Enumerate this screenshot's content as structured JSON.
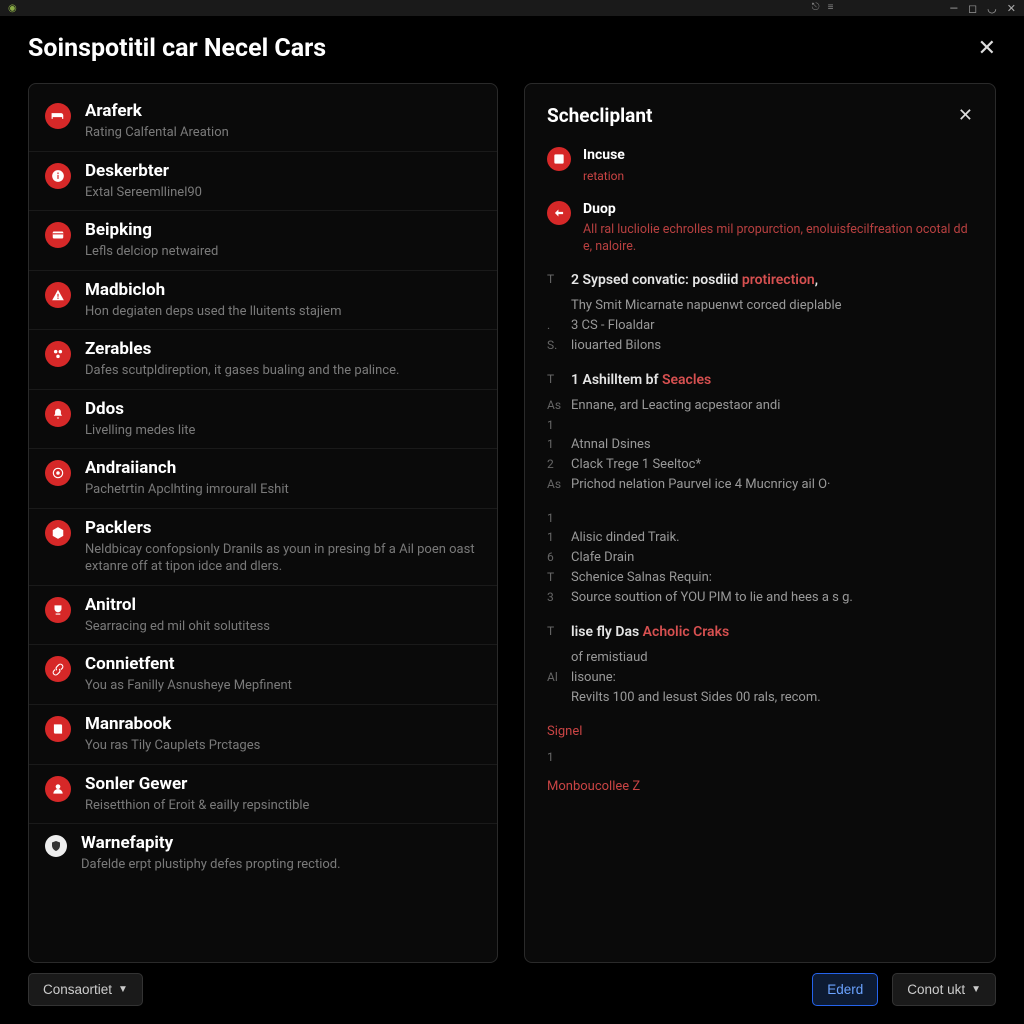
{
  "titlebar": {
    "win_min": "—",
    "win_max": "◻",
    "win_close": "✕"
  },
  "header": {
    "title": "Soinspotitil car Necel Cars",
    "close": "✕"
  },
  "left": {
    "items": [
      {
        "icon": "bed",
        "title": "Araferk",
        "desc": "Rating Calfental Areation"
      },
      {
        "icon": "info",
        "title": "Deskerbter",
        "desc": "Extal Sereemllinel90"
      },
      {
        "icon": "card",
        "title": "Beipking",
        "desc": "Lefls delciop netwaired"
      },
      {
        "icon": "warning",
        "title": "Madbicloh",
        "desc": "Hon degiaten deps used the lluitents stajiem"
      },
      {
        "icon": "circles",
        "title": "Zerables",
        "desc": "Dafes scutpldireption, it gases bualing and the palince."
      },
      {
        "icon": "bell",
        "title": "Ddos",
        "desc": "Livelling medes lite"
      },
      {
        "icon": "target",
        "title": "Andraiianch",
        "desc": "Pachetrtin Apclhting imrourall Eshit"
      },
      {
        "icon": "package",
        "title": "Packlers",
        "desc": "Neldbicay confopsionly Dranils as youn in presing bf a Ail poen oast extanre off at tipon idce and dlers."
      },
      {
        "icon": "cup",
        "title": "Anitrol",
        "desc": "Searracing ed mil ohit solutitess"
      },
      {
        "icon": "link",
        "title": "Connietfent",
        "desc": "You as Fanilly Asnusheye Mepfinent"
      },
      {
        "icon": "book",
        "title": "Manrabook",
        "desc": "You ras Tily Cauplets Prctages"
      },
      {
        "icon": "user",
        "title": "Sonler Gewer",
        "desc": "Reisetthion of Eroit & eailly repsinctible"
      },
      {
        "icon": "shield",
        "title": "Warnefapity",
        "desc": "Dafelde erpt plustiphy defes propting rectiod."
      }
    ]
  },
  "right": {
    "title": "Schecliplant",
    "close": "✕",
    "incuse": {
      "title": "Incuse",
      "sub": "retation"
    },
    "duop": {
      "title": "Duop",
      "text": "All ral lucliolie echrolles mil propurction, enoluisfecilfreation ocotal dd e, naloire."
    },
    "sections": [
      {
        "head_marker": "T",
        "head_pre": "2 Sypsed convatic: posdiid ",
        "head_hl": "protirection",
        "head_post": ",",
        "lines": [
          {
            "m": "",
            "t": "Thy Smit Micarnate napuenwt corced dieplable"
          },
          {
            "m": ".",
            "t": "3   CS - Floaldar"
          },
          {
            "m": "S.",
            "t": "liouarted Bilons"
          }
        ]
      },
      {
        "head_marker": "T",
        "head_pre": "1   Ashilltem bf ",
        "head_hl": "Seacles",
        "head_post": "",
        "lines": [
          {
            "m": "As",
            "t": "Ennane, ard Leacting acpestaor andi"
          },
          {
            "m": "1",
            "t": ""
          },
          {
            "m": "1",
            "t": "Atnnal Dsines"
          },
          {
            "m": "2",
            "t": "Clack Trege 1 Seeltoc*"
          },
          {
            "m": "As",
            "t": "Prichod nelation Paurvel ice 4 Mucnricy ail O·"
          }
        ]
      },
      {
        "head_marker": "1",
        "head_pre": "",
        "head_hl": "",
        "head_post": "",
        "lines": [
          {
            "m": "1",
            "t": "Alisic dinded Traik."
          },
          {
            "m": "6",
            "t": "Clafe Drain"
          },
          {
            "m": "T",
            "t": "Schenice Salnas Requin:"
          },
          {
            "m": "3",
            "t": "Source souttion of YOU PIM to lie and hees a s g."
          }
        ]
      },
      {
        "head_marker": "T",
        "head_pre": "lise fly Das ",
        "head_hl": "Acholic Craks",
        "head_post": "",
        "lines": [
          {
            "m": "",
            "t": "of remistiaud"
          },
          {
            "m": "Al",
            "t": "lisoune:"
          },
          {
            "m": "",
            "t": "Revilts 100 and lesust Sides 00 rals, recom."
          }
        ]
      }
    ],
    "signal1": "Signel",
    "signal_marker": "1",
    "signal2": "Monboucollee Z"
  },
  "footer": {
    "constrain": "Consaortiet",
    "primary": "Ederd",
    "secondary": "Conot ukt"
  }
}
